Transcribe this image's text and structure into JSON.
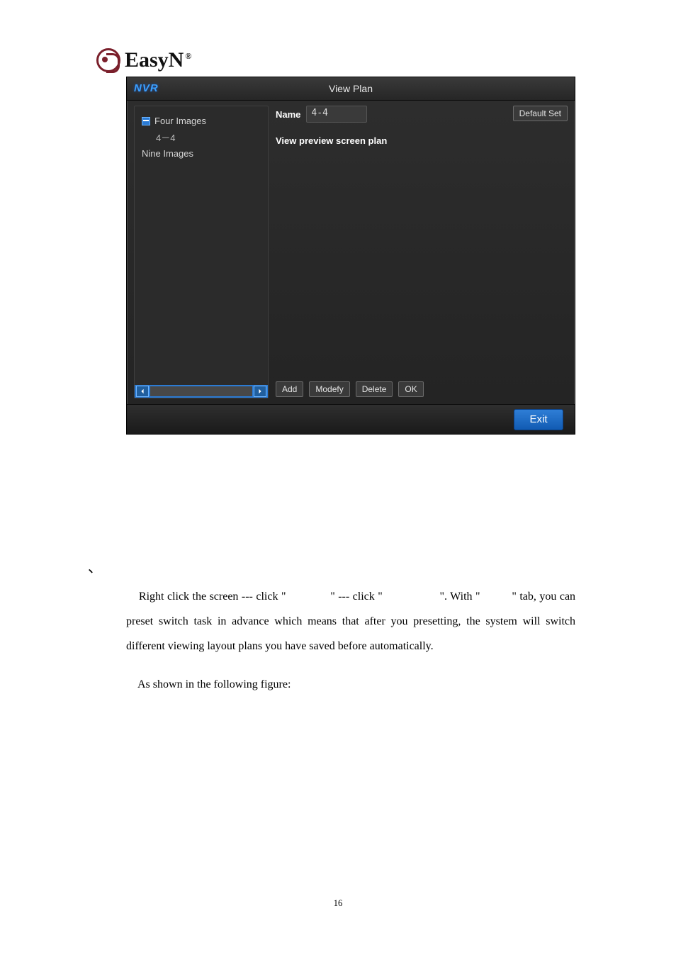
{
  "logo": {
    "brand": "EasyN",
    "registered": "®"
  },
  "dialog": {
    "app_brand": "NVR",
    "title": "View Plan",
    "sidebar": {
      "items": [
        {
          "label": "Four Images",
          "kind": "group"
        },
        {
          "label": "4－4",
          "kind": "child"
        },
        {
          "label": "Nine Images",
          "kind": "group-collapsed"
        }
      ]
    },
    "name_label": "Name",
    "name_value": "4-4",
    "default_set_label": "Default Set",
    "subheader": "View preview screen plan",
    "buttons": {
      "add": "Add",
      "modify": "Modefy",
      "delete": "Delete",
      "ok": "OK"
    },
    "exit_label": "Exit"
  },
  "body": {
    "backtick": "、",
    "para1_a": "Right click the screen --- click \"",
    "para1_b": "\" --- click \"",
    "para1_c": "\". With \"",
    "para1_d": "\" tab, you can preset switch task in advance which means that after you presetting, the system will switch different viewing layout plans you have saved before automatically.",
    "para2": "As shown in the following figure:"
  },
  "page_number": "16"
}
